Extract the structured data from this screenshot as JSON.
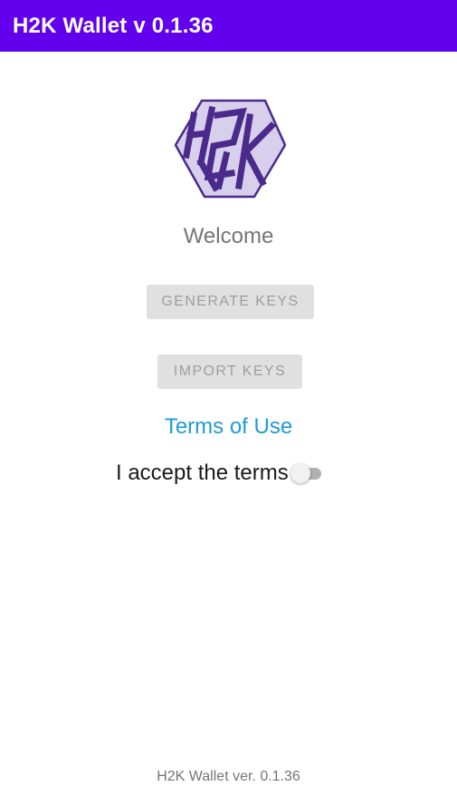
{
  "app": {
    "title": "H2K Wallet v 0.1.36",
    "logo_icon": "h2k-hexagon-logo",
    "colors": {
      "toolbar": "#6200ee",
      "link": "#1e9bd7",
      "button_bg": "#e0e0e0",
      "button_text": "#9e9e9e",
      "logo_fill": "#d8cfec",
      "logo_stroke": "#4a2b8c"
    }
  },
  "main": {
    "welcome": "Welcome",
    "generate_keys_label": "GENERATE KEYS",
    "import_keys_label": "IMPORT KEYS",
    "terms_link": "Terms of Use",
    "accept_label": "I accept the terms",
    "accept_switch_on": false
  },
  "footer": {
    "version": "H2K Wallet ver. 0.1.36"
  }
}
